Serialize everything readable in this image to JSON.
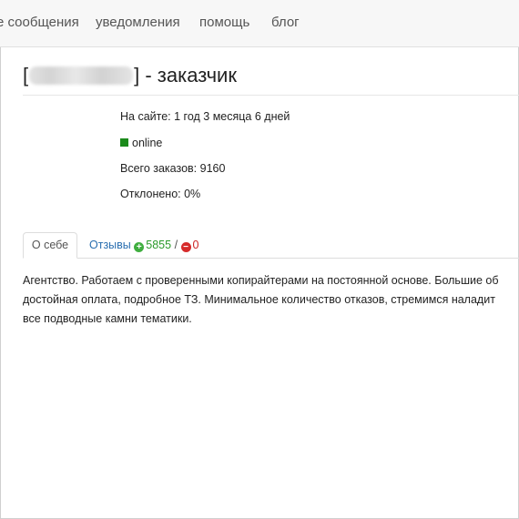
{
  "nav": {
    "items": [
      "е сообщения",
      "уведомления",
      "помощь",
      "блог"
    ]
  },
  "profile": {
    "title_open": "[",
    "title_close": "] - заказчик",
    "on_site": "На сайте: 1 год 3 месяца 6 дней",
    "status": "online",
    "total_orders": "Всего заказов: 9160",
    "rejected": "Отклонено: 0%"
  },
  "tabs": {
    "about_label": "О себе",
    "reviews_label": "Отзывы",
    "positive_count": "5855",
    "separator": "/",
    "negative_count": "0"
  },
  "about": {
    "lines": [
      "Агентство. Работаем с проверенными копирайтерами на постоянной основе. Большие об",
      "достойная оплата, подробное ТЗ. Минимальное количество отказов, стремимся наладит",
      "все подводные камни тематики."
    ]
  },
  "colors": {
    "online": "#1b8a1b",
    "positive": "#2a9a2a",
    "negative": "#cc2222",
    "link": "#2a6fb0"
  },
  "icons": {
    "status": "online-square-icon",
    "positive": "plus-circle-icon",
    "negative": "minus-circle-icon"
  }
}
